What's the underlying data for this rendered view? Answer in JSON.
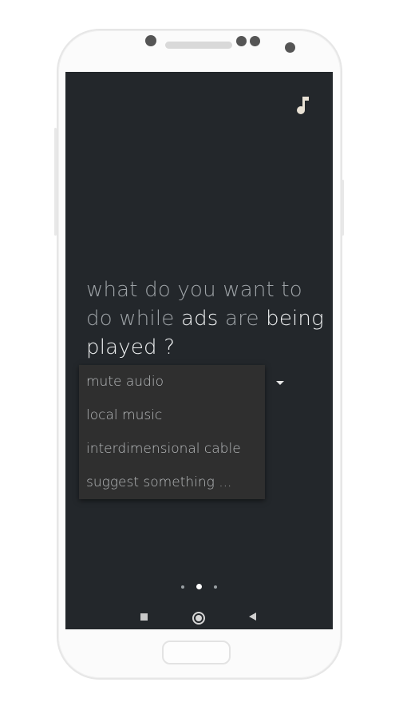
{
  "screen": {
    "question_part1": "what do you want to do while ",
    "question_highlight1": "ads",
    "question_part2": " are ",
    "question_highlight2": "being played ?"
  },
  "dropdown": {
    "options": [
      "mute audio",
      "local music",
      "interdimensional cable",
      "suggest something ..."
    ]
  },
  "pager": {
    "pages": 3,
    "active_index": 1
  },
  "icons": {
    "top_right": "music-note-icon",
    "dropdown": "dropdown-arrow-icon",
    "nav": [
      "recent-apps-icon",
      "home-icon",
      "back-icon"
    ]
  },
  "colors": {
    "screen_bg": "#23272b",
    "menu_bg": "#2f2f2f",
    "text_dim": "#9ea3a7",
    "text_bright": "#eef0f1"
  }
}
